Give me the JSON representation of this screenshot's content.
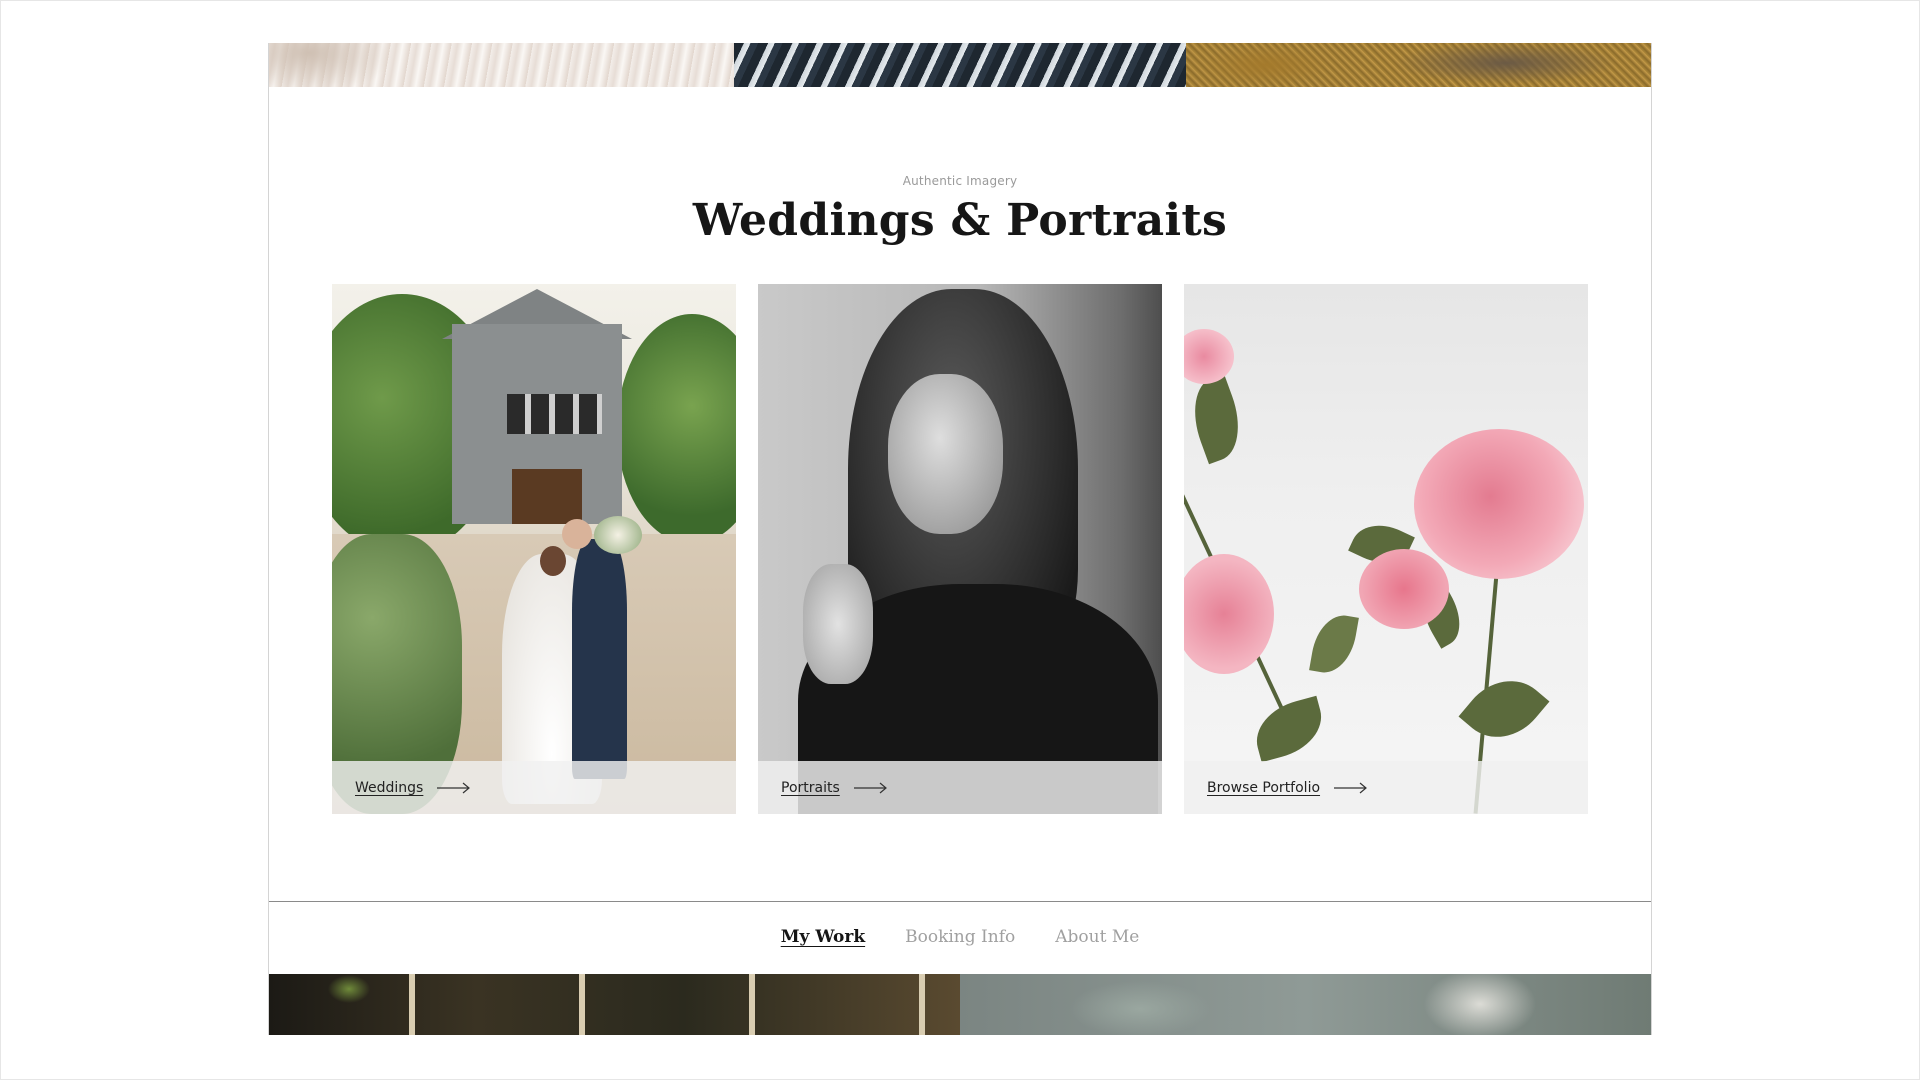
{
  "section": {
    "eyebrow": "Authentic Imagery",
    "title": "Weddings & Portraits"
  },
  "cards": [
    {
      "label": "Weddings",
      "photo": "couple-kissing-in-front-of-barn"
    },
    {
      "label": "Portraits",
      "photo": "black-and-white-woman-portrait"
    },
    {
      "label": "Browse Portfolio",
      "photo": "pink-roses"
    }
  ],
  "footer_nav": {
    "items": [
      {
        "label": "My Work",
        "active": true
      },
      {
        "label": "Booking Info",
        "active": false
      },
      {
        "label": "About Me",
        "active": false
      }
    ]
  },
  "icons": {
    "card_arrow": "arrow-right-icon"
  },
  "colors": {
    "title_text": "#161616",
    "eyebrow_text": "#9a9a9a",
    "nav_inactive": "#a0a0a0",
    "nav_active": "#151515",
    "card_bar": "#f0f0f0"
  }
}
